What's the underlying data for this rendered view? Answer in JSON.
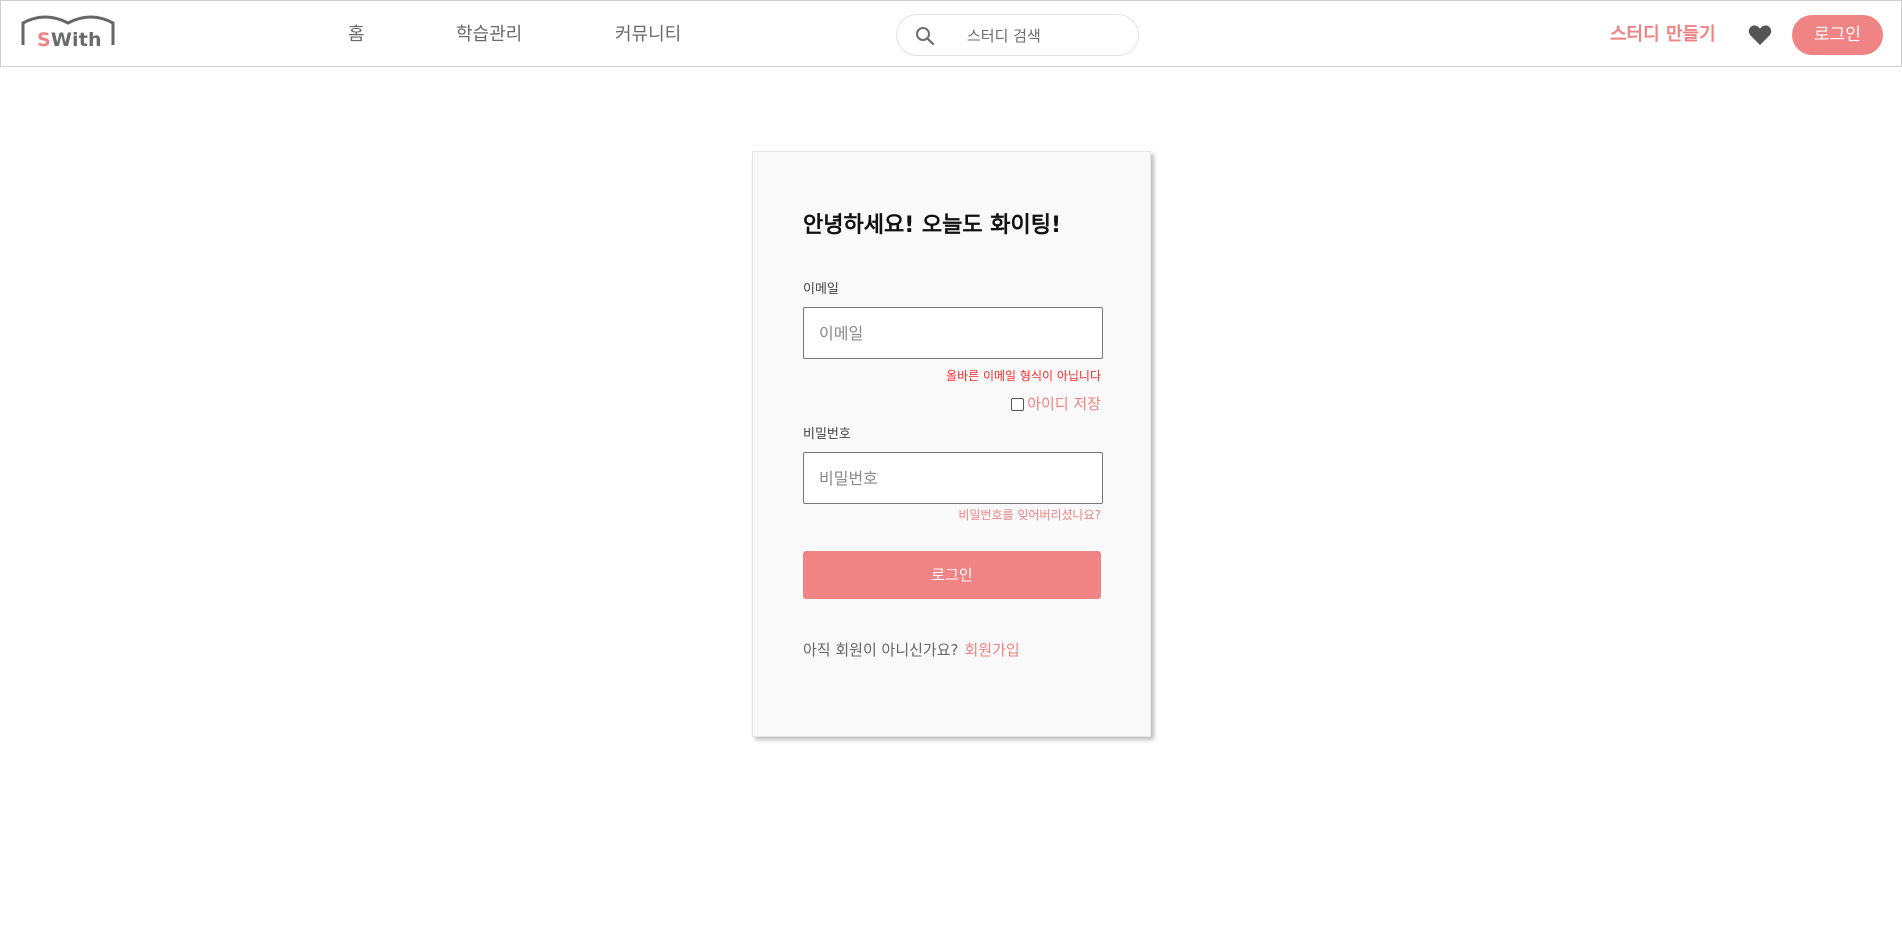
{
  "header": {
    "logo_text": "With",
    "logo_s": "S",
    "nav": [
      {
        "label": "홈"
      },
      {
        "label": "학습관리"
      },
      {
        "label": "커뮤니티"
      }
    ],
    "search": {
      "placeholder": "스터디 검색",
      "icon": "search-icon"
    },
    "make_study": "스터디 만들기",
    "heart_icon": "heart-icon",
    "login": "로그인"
  },
  "login_form": {
    "greeting": "안녕하세요! 오늘도 화이팅!",
    "email_label": "이메일",
    "email_placeholder": "이메일",
    "email_value": "",
    "email_error": "올바른 이메일 형식이 아닙니다",
    "remember_label": "아이디 저장",
    "remember_checked": false,
    "password_label": "비밀번호",
    "password_placeholder": "비밀번호",
    "password_value": "",
    "forgot": "비밀번호를 잊어버리셨나요?",
    "submit": "로그인",
    "signup_question": "아직 회원이 아니신가요?",
    "signup_link": "회원가입"
  },
  "colors": {
    "accent": "#f08383",
    "error": "#ff2a2a",
    "text_gray": "#6a6a6a"
  }
}
